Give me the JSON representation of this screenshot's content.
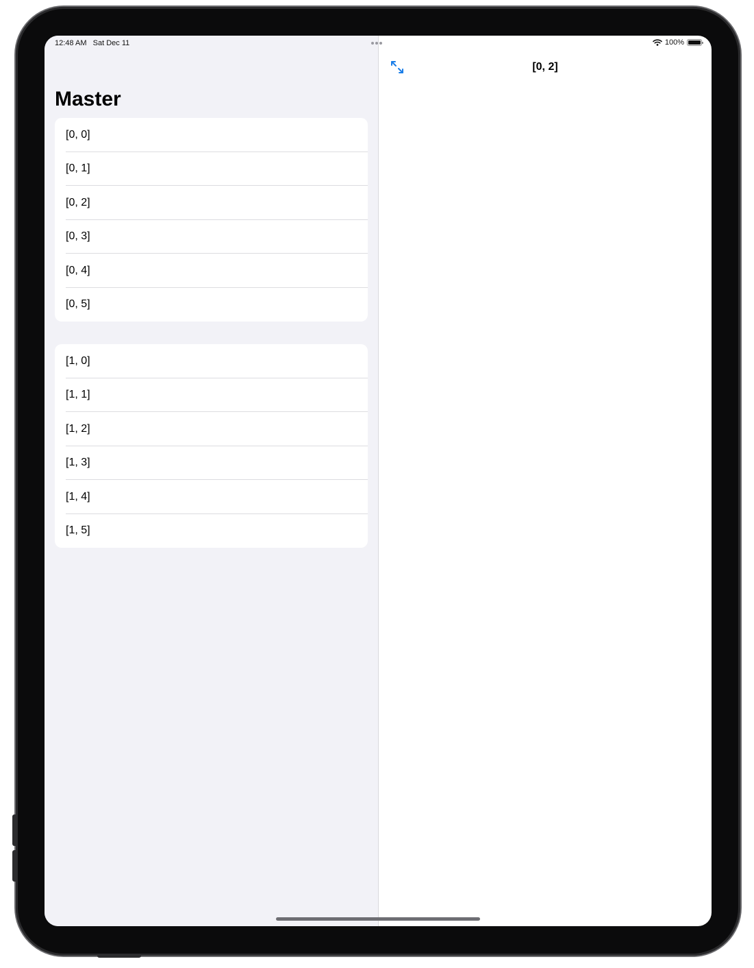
{
  "status_bar": {
    "time": "12:48 AM",
    "date": "Sat Dec 11",
    "battery": "100%",
    "wifi_icon": "wifi-icon",
    "battery_icon": "battery-full-icon"
  },
  "master": {
    "title": "Master",
    "sections": [
      {
        "rows": [
          "[0, 0]",
          "[0, 1]",
          "[0, 2]",
          "[0, 3]",
          "[0, 4]",
          "[0, 5]"
        ]
      },
      {
        "rows": [
          "[1, 0]",
          "[1, 1]",
          "[1, 2]",
          "[1, 3]",
          "[1, 4]",
          "[1, 5]"
        ]
      }
    ]
  },
  "detail": {
    "title": "[0, 2]",
    "expand_icon": "arrow-expand-icon"
  },
  "colors": {
    "accent": "#1a7ee8",
    "master_background": "#f2f2f7",
    "detail_background": "#ffffff"
  }
}
